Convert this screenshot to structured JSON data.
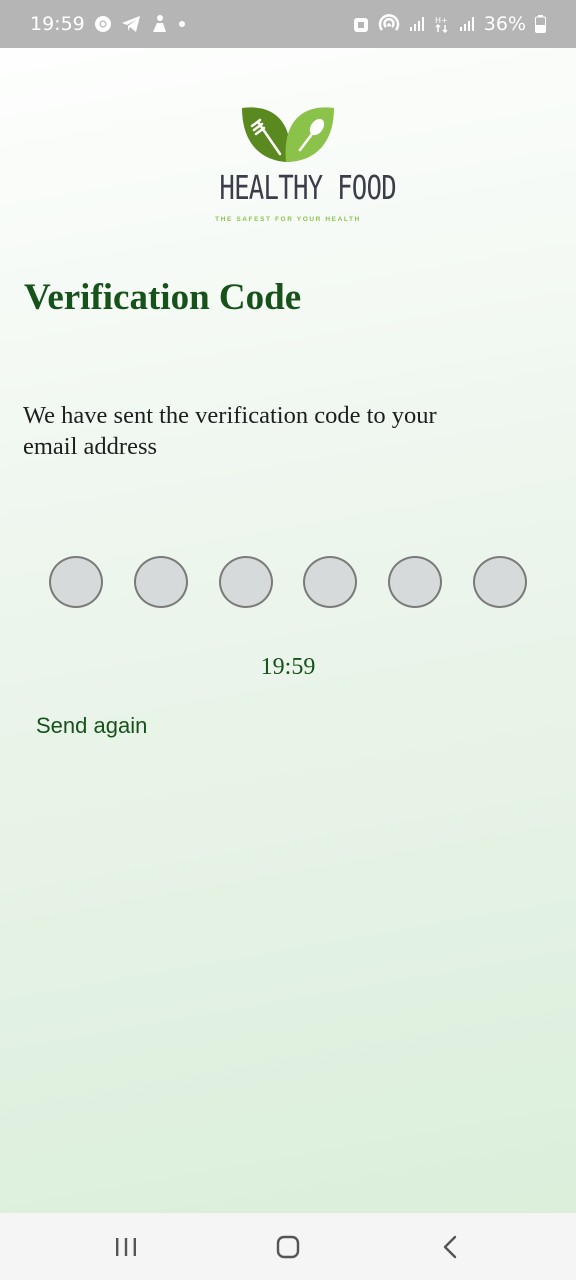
{
  "status_bar": {
    "time": "19:59",
    "battery": "36%",
    "left_icons": [
      "chrome-icon",
      "telegram-icon",
      "app-notification-icon",
      "dot-icon"
    ],
    "right_icons": [
      "lock-badge-icon",
      "hotspot-icon",
      "signal-icon",
      "data-icon",
      "signal-icon",
      "battery-icon"
    ]
  },
  "logo": {
    "title": "HEALTHY FOOD",
    "tagline": "THE SAFEST FOR YOUR HEALTH",
    "colors": {
      "dark_leaf": "#5a8a1f",
      "light_leaf": "#8bc34a"
    }
  },
  "page": {
    "title": "Verification Code",
    "subtitle": "We have sent the verification code to your email address",
    "timer": "19:59",
    "send_again": "Send again",
    "code_length": 6,
    "accent_color": "#17521b"
  },
  "nav_bar": {
    "icons": [
      "recent-apps-icon",
      "home-icon",
      "back-icon"
    ]
  }
}
